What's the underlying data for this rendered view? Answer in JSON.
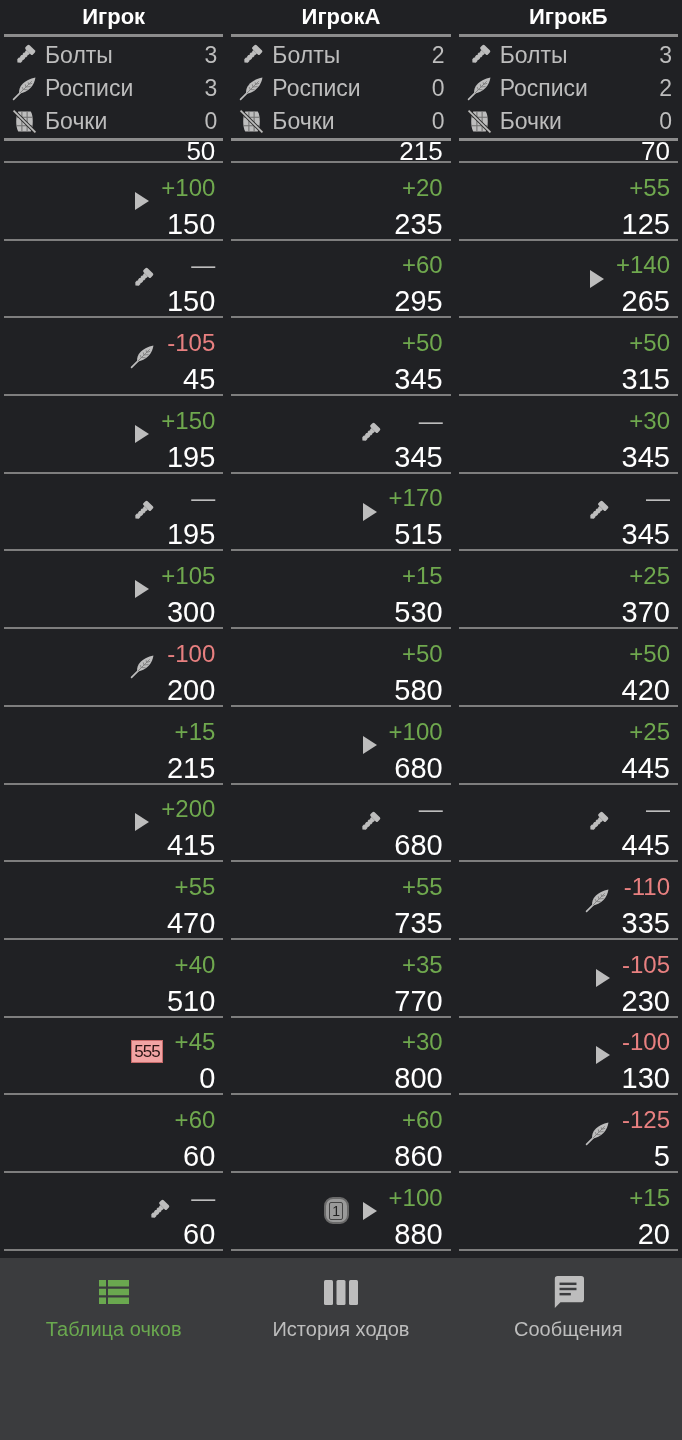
{
  "players": [
    {
      "name": "Игрок",
      "stats": [
        {
          "kind": "bolts",
          "label": "Болты",
          "value": "3"
        },
        {
          "kind": "signatures",
          "label": "Росписи",
          "value": "3"
        },
        {
          "kind": "barrels",
          "label": "Бочки",
          "value": "0"
        }
      ],
      "cut_off_total": "50",
      "turns": [
        {
          "markers": [
            {
              "kind": "play"
            }
          ],
          "delta": "+100",
          "kind": "gain",
          "total": "150"
        },
        {
          "markers": [
            {
              "kind": "bolt"
            }
          ],
          "delta": "—",
          "kind": "none",
          "total": "150"
        },
        {
          "markers": [
            {
              "kind": "feather"
            }
          ],
          "delta": "-105",
          "kind": "loss",
          "total": "45"
        },
        {
          "markers": [
            {
              "kind": "play"
            }
          ],
          "delta": "+150",
          "kind": "gain",
          "total": "195"
        },
        {
          "markers": [
            {
              "kind": "bolt"
            }
          ],
          "delta": "—",
          "kind": "none",
          "total": "195"
        },
        {
          "markers": [
            {
              "kind": "play"
            }
          ],
          "delta": "+105",
          "kind": "gain",
          "total": "300"
        },
        {
          "markers": [
            {
              "kind": "feather"
            }
          ],
          "delta": "-100",
          "kind": "loss",
          "total": "200"
        },
        {
          "delta": "+15",
          "kind": "gain",
          "total": "215"
        },
        {
          "markers": [
            {
              "kind": "play"
            }
          ],
          "delta": "+200",
          "kind": "gain",
          "total": "415"
        },
        {
          "delta": "+55",
          "kind": "gain",
          "total": "470"
        },
        {
          "delta": "+40",
          "kind": "gain",
          "total": "510"
        },
        {
          "markers": [
            {
              "kind": "tag",
              "text": "555"
            }
          ],
          "delta": "+45",
          "kind": "gain",
          "total": "0"
        },
        {
          "delta": "+60",
          "kind": "gain",
          "total": "60"
        },
        {
          "markers": [
            {
              "kind": "bolt"
            }
          ],
          "delta": "—",
          "kind": "none",
          "total": "60"
        }
      ]
    },
    {
      "name": "ИгрокА",
      "stats": [
        {
          "kind": "bolts",
          "label": "Болты",
          "value": "2"
        },
        {
          "kind": "signatures",
          "label": "Росписи",
          "value": "0"
        },
        {
          "kind": "barrels",
          "label": "Бочки",
          "value": "0"
        }
      ],
      "cut_off_total": "215",
      "turns": [
        {
          "delta": "+20",
          "kind": "gain",
          "total": "235"
        },
        {
          "delta": "+60",
          "kind": "gain",
          "total": "295"
        },
        {
          "delta": "+50",
          "kind": "gain",
          "total": "345"
        },
        {
          "markers": [
            {
              "kind": "bolt"
            }
          ],
          "delta": "—",
          "kind": "none",
          "total": "345"
        },
        {
          "markers": [
            {
              "kind": "play"
            }
          ],
          "delta": "+170",
          "kind": "gain",
          "total": "515"
        },
        {
          "delta": "+15",
          "kind": "gain",
          "total": "530"
        },
        {
          "delta": "+50",
          "kind": "gain",
          "total": "580"
        },
        {
          "markers": [
            {
              "kind": "play"
            }
          ],
          "delta": "+100",
          "kind": "gain",
          "total": "680"
        },
        {
          "markers": [
            {
              "kind": "bolt"
            }
          ],
          "delta": "—",
          "kind": "none",
          "total": "680"
        },
        {
          "delta": "+55",
          "kind": "gain",
          "total": "735"
        },
        {
          "delta": "+35",
          "kind": "gain",
          "total": "770"
        },
        {
          "delta": "+30",
          "kind": "gain",
          "total": "800"
        },
        {
          "delta": "+60",
          "kind": "gain",
          "total": "860"
        },
        {
          "markers": [
            {
              "kind": "barrel",
              "text": "1"
            },
            {
              "kind": "play"
            }
          ],
          "delta": "+100",
          "kind": "gain",
          "total": "880"
        }
      ]
    },
    {
      "name": "ИгрокБ",
      "stats": [
        {
          "kind": "bolts",
          "label": "Болты",
          "value": "3"
        },
        {
          "kind": "signatures",
          "label": "Росписи",
          "value": "2"
        },
        {
          "kind": "barrels",
          "label": "Бочки",
          "value": "0"
        }
      ],
      "cut_off_total": "70",
      "turns": [
        {
          "delta": "+55",
          "kind": "gain",
          "total": "125"
        },
        {
          "markers": [
            {
              "kind": "play"
            }
          ],
          "delta": "+140",
          "kind": "gain",
          "total": "265"
        },
        {
          "delta": "+50",
          "kind": "gain",
          "total": "315"
        },
        {
          "delta": "+30",
          "kind": "gain",
          "total": "345"
        },
        {
          "markers": [
            {
              "kind": "bolt"
            }
          ],
          "delta": "—",
          "kind": "none",
          "total": "345"
        },
        {
          "delta": "+25",
          "kind": "gain",
          "total": "370"
        },
        {
          "delta": "+50",
          "kind": "gain",
          "total": "420"
        },
        {
          "delta": "+25",
          "kind": "gain",
          "total": "445"
        },
        {
          "markers": [
            {
              "kind": "bolt"
            }
          ],
          "delta": "—",
          "kind": "none",
          "total": "445"
        },
        {
          "markers": [
            {
              "kind": "feather"
            }
          ],
          "delta": "-110",
          "kind": "loss",
          "total": "335"
        },
        {
          "markers": [
            {
              "kind": "play"
            }
          ],
          "delta": "-105",
          "kind": "loss",
          "total": "230"
        },
        {
          "markers": [
            {
              "kind": "play"
            }
          ],
          "delta": "-100",
          "kind": "loss",
          "total": "130"
        },
        {
          "markers": [
            {
              "kind": "feather"
            }
          ],
          "delta": "-125",
          "kind": "loss",
          "total": "5"
        },
        {
          "delta": "+15",
          "kind": "gain",
          "total": "20"
        }
      ]
    }
  ],
  "bottom_nav": [
    {
      "kind": "table",
      "label": "Таблица очков",
      "selected": true
    },
    {
      "kind": "history",
      "label": "История ходов",
      "selected": false
    },
    {
      "kind": "messages",
      "label": "Сообщения",
      "selected": false
    }
  ]
}
